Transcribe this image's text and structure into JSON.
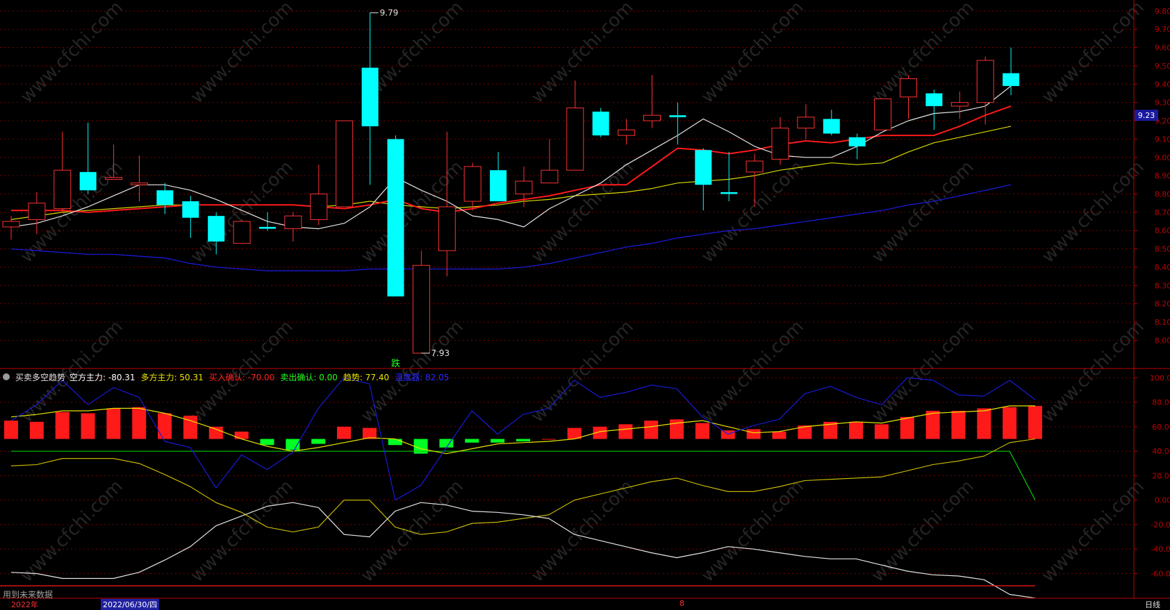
{
  "colors": {
    "up": "#ff3232",
    "down": "#00ffff",
    "ma5": "#e6e6e6",
    "ma10": "#ff1a1a",
    "ma20": "#d8d800",
    "ma60": "#1a1ad8",
    "axis": "#c00000",
    "grid": "#7a0000"
  },
  "chart_data": [
    {
      "type": "candlestick",
      "title": "",
      "ylim": [
        7.85,
        9.86
      ],
      "yticks": [
        8.0,
        8.1,
        8.2,
        8.3,
        8.4,
        8.5,
        8.6,
        8.7,
        8.8,
        8.9,
        9.0,
        9.1,
        9.2,
        9.3,
        9.4,
        9.5,
        9.6,
        9.7,
        9.8
      ],
      "ytick_labels": [
        "8.00",
        "8.10",
        "8.20",
        "8.30",
        "8.40",
        "8.50",
        "8.60",
        "8.70",
        "8.80",
        "8.90",
        "9.00",
        "9.10",
        "9.20",
        "9.30",
        "9.40",
        "9.50",
        "9.60",
        "9.70",
        "9.80"
      ],
      "last_price_label": "9.23",
      "max_label": "9.79",
      "min_label": "7.93",
      "signal_label": "跌",
      "candles": [
        {
          "o": 8.62,
          "h": 8.68,
          "l": 8.55,
          "c": 8.65
        },
        {
          "o": 8.66,
          "h": 8.81,
          "l": 8.58,
          "c": 8.75
        },
        {
          "o": 8.72,
          "h": 9.14,
          "l": 8.7,
          "c": 8.93
        },
        {
          "o": 8.92,
          "h": 9.19,
          "l": 8.8,
          "c": 8.82
        },
        {
          "o": 8.88,
          "h": 9.07,
          "l": 8.88,
          "c": 8.89
        },
        {
          "o": 8.85,
          "h": 9.01,
          "l": 8.76,
          "c": 8.86
        },
        {
          "o": 8.82,
          "h": 8.86,
          "l": 8.69,
          "c": 8.74
        },
        {
          "o": 8.76,
          "h": 8.79,
          "l": 8.56,
          "c": 8.67
        },
        {
          "o": 8.68,
          "h": 8.7,
          "l": 8.47,
          "c": 8.54
        },
        {
          "o": 8.53,
          "h": 8.66,
          "l": 8.53,
          "c": 8.65
        },
        {
          "o": 8.62,
          "h": 8.7,
          "l": 8.6,
          "c": 8.61
        },
        {
          "o": 8.61,
          "h": 8.7,
          "l": 8.54,
          "c": 8.68
        },
        {
          "o": 8.66,
          "h": 8.96,
          "l": 8.63,
          "c": 8.8
        },
        {
          "o": 8.73,
          "h": 9.2,
          "l": 8.73,
          "c": 9.2
        },
        {
          "o": 9.49,
          "h": 9.79,
          "l": 8.85,
          "c": 9.17
        },
        {
          "o": 9.1,
          "h": 9.12,
          "l": 8.24,
          "c": 8.24
        },
        {
          "o": 7.93,
          "h": 8.49,
          "l": 7.93,
          "c": 8.41
        },
        {
          "o": 8.49,
          "h": 9.14,
          "l": 8.35,
          "c": 8.73
        },
        {
          "o": 8.76,
          "h": 8.97,
          "l": 8.71,
          "c": 8.95
        },
        {
          "o": 8.93,
          "h": 9.03,
          "l": 8.76,
          "c": 8.76
        },
        {
          "o": 8.8,
          "h": 8.95,
          "l": 8.73,
          "c": 8.87
        },
        {
          "o": 8.86,
          "h": 9.1,
          "l": 8.86,
          "c": 8.93
        },
        {
          "o": 8.93,
          "h": 9.42,
          "l": 8.93,
          "c": 9.27
        },
        {
          "o": 9.25,
          "h": 9.27,
          "l": 9.11,
          "c": 9.12
        },
        {
          "o": 9.12,
          "h": 9.21,
          "l": 9.07,
          "c": 9.15
        },
        {
          "o": 9.2,
          "h": 9.45,
          "l": 9.16,
          "c": 9.23
        },
        {
          "o": 9.23,
          "h": 9.3,
          "l": 9.07,
          "c": 9.22
        },
        {
          "o": 9.04,
          "h": 9.05,
          "l": 8.71,
          "c": 8.85
        },
        {
          "o": 8.81,
          "h": 9.03,
          "l": 8.76,
          "c": 8.8
        },
        {
          "o": 8.92,
          "h": 9.02,
          "l": 8.73,
          "c": 8.98
        },
        {
          "o": 8.99,
          "h": 9.22,
          "l": 8.96,
          "c": 9.16
        },
        {
          "o": 9.16,
          "h": 9.29,
          "l": 9.1,
          "c": 9.22
        },
        {
          "o": 9.21,
          "h": 9.26,
          "l": 9.12,
          "c": 9.13
        },
        {
          "o": 9.11,
          "h": 9.13,
          "l": 8.99,
          "c": 9.06
        },
        {
          "o": 9.15,
          "h": 9.32,
          "l": 9.15,
          "c": 9.32
        },
        {
          "o": 9.33,
          "h": 9.45,
          "l": 9.21,
          "c": 9.43
        },
        {
          "o": 9.35,
          "h": 9.37,
          "l": 9.15,
          "c": 9.28
        },
        {
          "o": 9.28,
          "h": 9.36,
          "l": 9.21,
          "c": 9.3
        },
        {
          "o": 9.3,
          "h": 9.55,
          "l": 9.18,
          "c": 9.53
        },
        {
          "o": 9.46,
          "h": 9.6,
          "l": 9.34,
          "c": 9.39
        }
      ],
      "ma5": [
        8.62,
        8.64,
        8.68,
        8.73,
        8.79,
        8.85,
        8.85,
        8.82,
        8.77,
        8.71,
        8.65,
        8.62,
        8.61,
        8.64,
        8.73,
        8.89,
        8.82,
        8.76,
        8.68,
        8.66,
        8.62,
        8.72,
        8.79,
        8.86,
        8.96,
        9.04,
        9.12,
        9.21,
        9.14,
        9.06,
        9.01,
        9.0,
        9.0,
        9.06,
        9.14,
        9.2,
        9.24,
        9.25,
        9.28,
        9.39
      ],
      "ma10": [
        8.71,
        8.71,
        8.71,
        8.7,
        8.71,
        8.72,
        8.73,
        8.74,
        8.74,
        8.74,
        8.74,
        8.74,
        8.73,
        8.72,
        8.74,
        8.77,
        8.72,
        8.7,
        8.72,
        8.75,
        8.77,
        8.79,
        8.82,
        8.85,
        8.85,
        8.95,
        9.05,
        9.04,
        9.02,
        9.04,
        9.07,
        9.09,
        9.08,
        9.1,
        9.12,
        9.12,
        9.12,
        9.17,
        9.23,
        9.28
      ],
      "ma20": [
        8.66,
        8.68,
        8.7,
        8.71,
        8.72,
        8.73,
        8.74,
        8.74,
        8.74,
        8.74,
        8.74,
        8.74,
        8.73,
        8.74,
        8.76,
        8.74,
        8.73,
        8.72,
        8.73,
        8.74,
        8.76,
        8.77,
        8.79,
        8.8,
        8.81,
        8.83,
        8.86,
        8.87,
        8.88,
        8.9,
        8.93,
        8.95,
        8.97,
        8.96,
        8.97,
        9.03,
        9.08,
        9.11,
        9.14,
        9.17
      ],
      "ma60": [
        8.5,
        8.49,
        8.48,
        8.47,
        8.47,
        8.46,
        8.45,
        8.42,
        8.4,
        8.39,
        8.38,
        8.38,
        8.38,
        8.38,
        8.39,
        8.39,
        8.39,
        8.39,
        8.39,
        8.39,
        8.4,
        8.42,
        8.45,
        8.48,
        8.51,
        8.53,
        8.56,
        8.58,
        8.6,
        8.61,
        8.63,
        8.65,
        8.67,
        8.69,
        8.71,
        8.74,
        8.76,
        8.79,
        8.82,
        8.85
      ]
    },
    {
      "type": "indicator",
      "title": "买卖多空趋势",
      "ylim": [
        -79,
        107
      ],
      "yticks": [
        100,
        80,
        60,
        40,
        20,
        0,
        -20,
        -40,
        -60
      ],
      "ytick_labels": [
        "100.00",
        "80.00",
        "60.00",
        "40.00",
        "20.00",
        "0.00",
        "-20.00",
        "-40.00",
        "-60.00"
      ],
      "legend": [
        {
          "label": "空方主力:",
          "value": "-80.31",
          "color": "#ffffff"
        },
        {
          "label": "多方主力:",
          "value": "50.31",
          "color": "#e6e600"
        },
        {
          "label": "买入确认:",
          "value": "-70.00",
          "color": "#ff2222"
        },
        {
          "label": "卖出确认:",
          "value": "0.00",
          "color": "#22ff22"
        },
        {
          "label": "趋势:",
          "value": "77.40",
          "color": "#e6e600"
        },
        {
          "label": "温度器:",
          "value": "82.05",
          "color": "#2b2bff"
        }
      ],
      "bars": [
        65,
        64,
        72,
        71,
        75,
        76,
        71,
        69,
        60,
        56,
        45,
        41,
        46,
        60,
        59,
        45,
        38,
        43,
        47,
        47,
        48,
        50,
        59,
        60,
        62,
        65,
        66,
        63,
        57,
        58,
        56,
        61,
        64,
        64,
        62,
        68,
        73,
        73,
        75,
        76,
        77
      ],
      "bars_base": 50,
      "trend": [
        68,
        70,
        73,
        73,
        75,
        75,
        71,
        65,
        58,
        50,
        44,
        40,
        43,
        47,
        51,
        50,
        42,
        38,
        42,
        46,
        47,
        48,
        50,
        56,
        58,
        60,
        63,
        65,
        60,
        55,
        56,
        60,
        62,
        64,
        63,
        67,
        71,
        72,
        73,
        77,
        77
      ],
      "bull": [
        28,
        29,
        34,
        34,
        34,
        30,
        21,
        11,
        -2,
        -10,
        -22,
        -26,
        -22,
        0,
        0,
        -22,
        -28,
        -26,
        -19,
        -18,
        -15,
        -12,
        0,
        5,
        10,
        15,
        18,
        12,
        7,
        7,
        11,
        16,
        17,
        18,
        19,
        24,
        29,
        32,
        36,
        47,
        50
      ],
      "bear": [
        -59,
        -60,
        -64,
        -64,
        -64,
        -59,
        -49,
        -38,
        -21,
        -13,
        -5,
        -2,
        -6,
        -28,
        -30,
        -9,
        -2,
        -4,
        -9,
        -10,
        -12,
        -15,
        -28,
        -33,
        -38,
        -43,
        -47,
        -43,
        -38,
        -40,
        -43,
        -46,
        -48,
        -48,
        -53,
        -58,
        -61,
        -62,
        -65,
        -77,
        -80
      ],
      "temp": [
        65,
        78,
        98,
        78,
        92,
        84,
        48,
        43,
        10,
        37,
        25,
        39,
        75,
        100,
        95,
        0,
        12,
        43,
        73,
        54,
        70,
        75,
        98,
        84,
        88,
        94,
        91,
        68,
        54,
        61,
        66,
        87,
        93,
        84,
        78,
        100,
        98,
        86,
        85,
        98,
        82
      ],
      "sell_line": [
        40,
        40,
        40,
        40,
        40,
        40,
        40,
        40,
        40,
        40,
        40,
        40,
        40,
        40,
        40,
        40,
        40,
        40,
        40,
        40,
        40,
        40,
        40,
        40,
        40,
        40,
        40,
        40,
        40,
        40,
        40,
        40,
        40,
        40,
        40,
        40,
        40,
        40,
        40,
        40,
        0
      ],
      "buy_level": -70
    }
  ],
  "watermark": "www.cfchi.com",
  "footer": {
    "note": "用到未来数据",
    "year": "2022年",
    "date_label": "2022/06/30/四",
    "month_marker": "8",
    "period": "日线"
  }
}
